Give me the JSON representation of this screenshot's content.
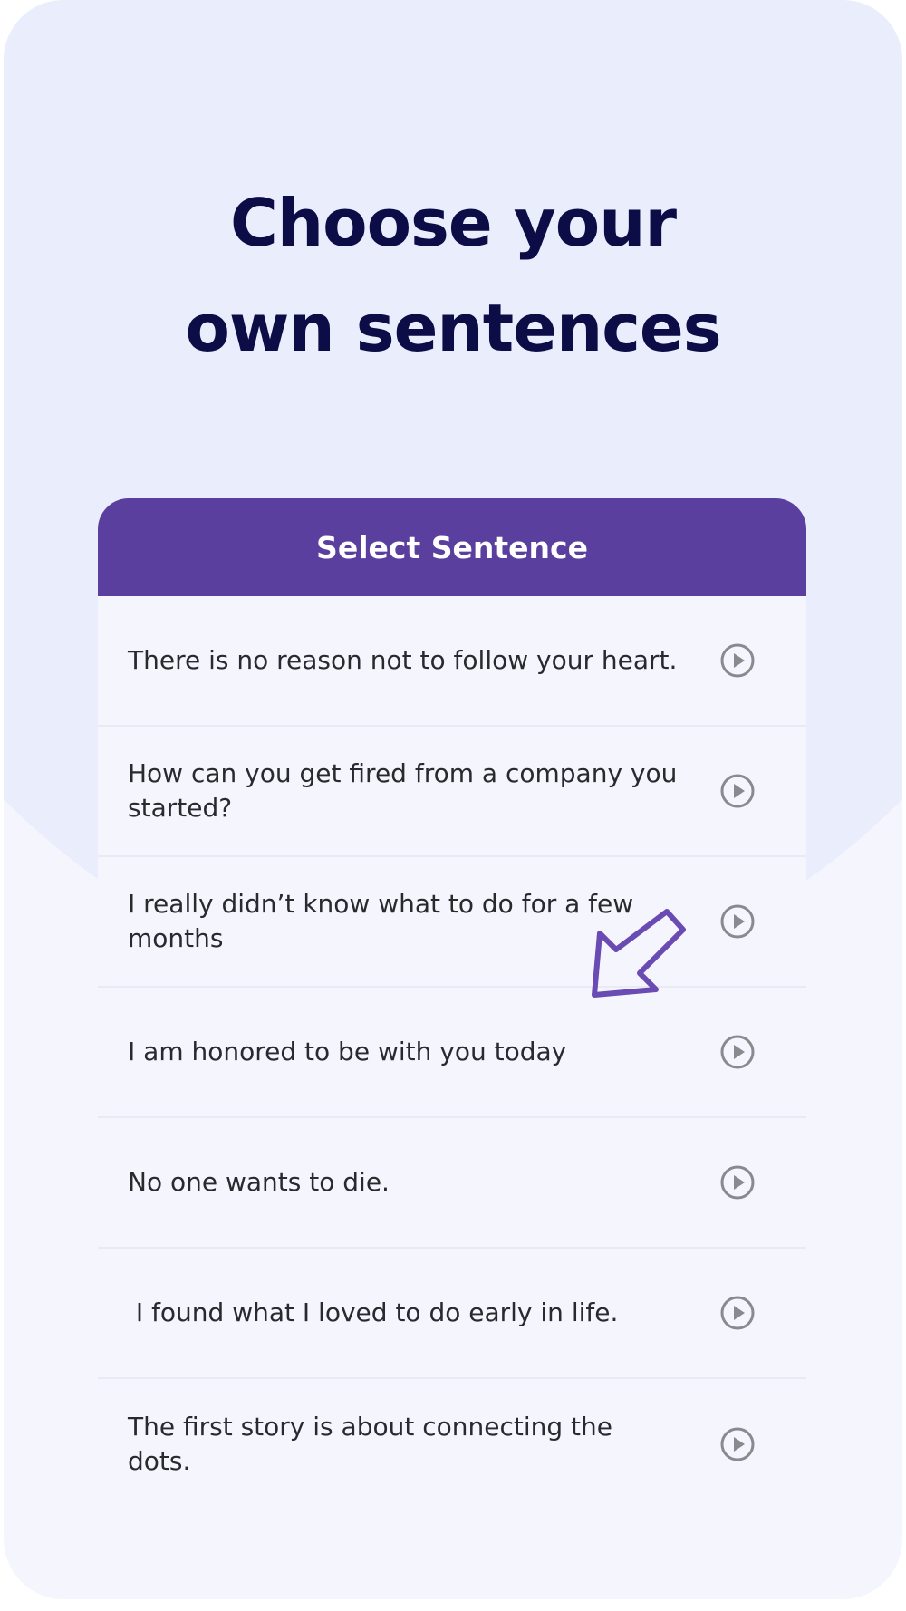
{
  "headline": {
    "line1": "Choose your",
    "line2": "own sentences"
  },
  "card": {
    "header_title": "Select Sentence",
    "sentences": [
      "There is no reason not to follow your heart.",
      "How can you get fired from a company you started?",
      "I really didn’t know what to do for a few months",
      "I am honored to be with you today",
      "No one wants to die.",
      " I found what I loved to do early in life.",
      "The first story is about connecting the dots."
    ],
    "row_icon": "play-circle-icon"
  },
  "annotation": {
    "icon": "arrow-down-left-icon",
    "color": "#6a4bb3"
  },
  "colors": {
    "header_bg": "#5b3f9f",
    "headline_text": "#0c0c47",
    "background": "#eaedfc"
  }
}
